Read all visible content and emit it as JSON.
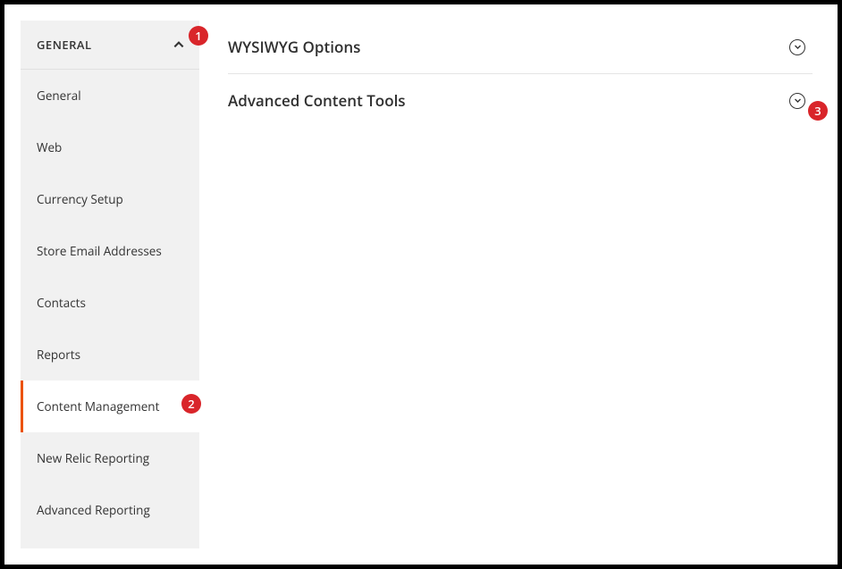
{
  "sidebar": {
    "header": "GENERAL",
    "items": [
      {
        "label": "General",
        "active": false
      },
      {
        "label": "Web",
        "active": false
      },
      {
        "label": "Currency Setup",
        "active": false
      },
      {
        "label": "Store Email Addresses",
        "active": false
      },
      {
        "label": "Contacts",
        "active": false
      },
      {
        "label": "Reports",
        "active": false
      },
      {
        "label": "Content Management",
        "active": true
      },
      {
        "label": "New Relic Reporting",
        "active": false
      },
      {
        "label": "Advanced Reporting",
        "active": false
      }
    ]
  },
  "main": {
    "sections": [
      {
        "title": "WYSIWYG Options"
      },
      {
        "title": "Advanced Content Tools"
      }
    ]
  },
  "annotations": {
    "b1": "1",
    "b2": "2",
    "b3": "3"
  }
}
